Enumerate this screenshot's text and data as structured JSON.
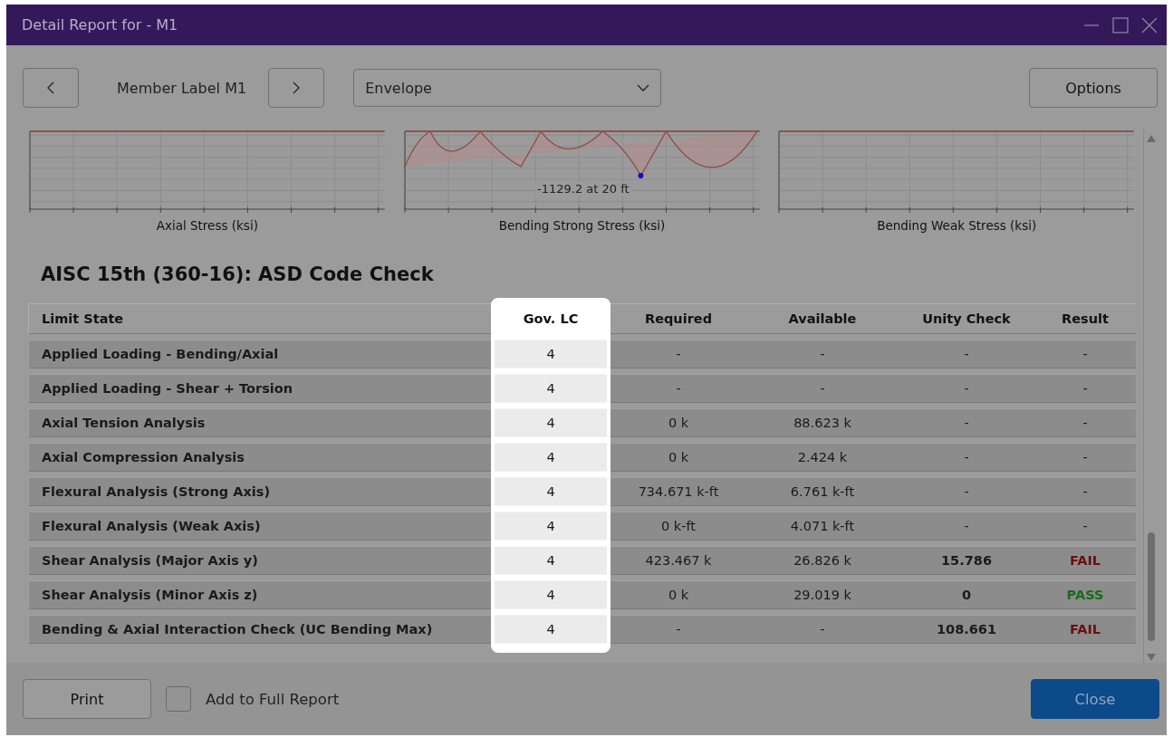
{
  "window": {
    "title": "Detail Report for - M1"
  },
  "toolbar": {
    "member_label": "Member Label M1",
    "combo_value": "Envelope",
    "options_button": "Options"
  },
  "charts": [
    {
      "title": "Axial Stress (ksi)",
      "kind": "flat"
    },
    {
      "title": "Bending Strong Stress (ksi)",
      "kind": "curve",
      "annotation": "-1129.2 at 20 ft"
    },
    {
      "title": "Bending Weak Stress (ksi)",
      "kind": "flat"
    }
  ],
  "section_title": "AISC 15th (360-16): ASD Code Check",
  "table": {
    "columns": [
      {
        "label": "Limit State",
        "selected": false
      },
      {
        "label": "Gov. LC",
        "selected": true
      },
      {
        "label": "Required",
        "selected": false
      },
      {
        "label": "Available",
        "selected": false
      },
      {
        "label": "Unity Check",
        "selected": false
      },
      {
        "label": "Result",
        "selected": false
      }
    ],
    "rows": [
      {
        "limit_state": "Applied Loading - Bending/Axial",
        "gov_lc": "4",
        "required": "-",
        "available": "-",
        "unity_check": "-",
        "result": "-",
        "kind": "plain"
      },
      {
        "limit_state": "Applied Loading - Shear + Torsion",
        "gov_lc": "4",
        "required": "-",
        "available": "-",
        "unity_check": "-",
        "result": "-",
        "kind": "plain"
      },
      {
        "limit_state": "Axial Tension Analysis",
        "gov_lc": "4",
        "required": "0 k",
        "available": "88.623 k",
        "unity_check": "-",
        "result": "-",
        "kind": "plain"
      },
      {
        "limit_state": "Axial Compression Analysis",
        "gov_lc": "4",
        "required": "0 k",
        "available": "2.424 k",
        "unity_check": "-",
        "result": "-",
        "kind": "plain"
      },
      {
        "limit_state": "Flexural Analysis (Strong Axis)",
        "gov_lc": "4",
        "required": "734.671 k-ft",
        "available": "6.761 k-ft",
        "unity_check": "-",
        "result": "-",
        "kind": "plain"
      },
      {
        "limit_state": "Flexural Analysis (Weak Axis)",
        "gov_lc": "4",
        "required": "0 k-ft",
        "available": "4.071 k-ft",
        "unity_check": "-",
        "result": "-",
        "kind": "plain"
      },
      {
        "limit_state": "Shear Analysis (Major Axis y)",
        "gov_lc": "4",
        "required": "423.467 k",
        "available": "26.826 k",
        "unity_check": "15.786",
        "result": "FAIL",
        "kind": "fail"
      },
      {
        "limit_state": "Shear Analysis (Minor Axis z)",
        "gov_lc": "4",
        "required": "0 k",
        "available": "29.019 k",
        "unity_check": "0",
        "result": "PASS",
        "kind": "pass"
      },
      {
        "limit_state": "Bending & Axial Interaction Check (UC Bending Max)",
        "gov_lc": "4",
        "required": "-",
        "available": "-",
        "unity_check": "108.661",
        "result": "FAIL",
        "kind": "fail"
      }
    ]
  },
  "footer": {
    "print_button": "Print",
    "add_to_report": {
      "label": "Add to Full Report",
      "checked": false
    },
    "close_button": "Close"
  }
}
